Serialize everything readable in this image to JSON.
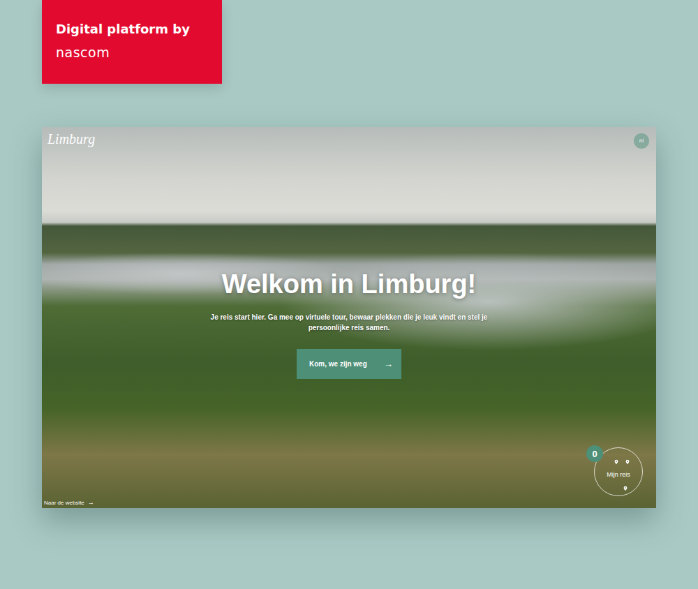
{
  "badge": {
    "title": "Digital platform by",
    "logo": "nascom"
  },
  "site": {
    "logo": "Limburg",
    "language": "nl",
    "heading": "Welkom in Limburg!",
    "intro": "Je reis start hier. Ga mee op virtuele tour, bewaar plekken die je leuk vindt en stel je persoonlijke reis samen.",
    "cta": {
      "label": "Kom, we zijn weg",
      "arrow": "→"
    },
    "website_link": {
      "label": "Naar de website",
      "arrow": "→"
    },
    "trip": {
      "label": "Mijn reis",
      "count": "0"
    }
  }
}
